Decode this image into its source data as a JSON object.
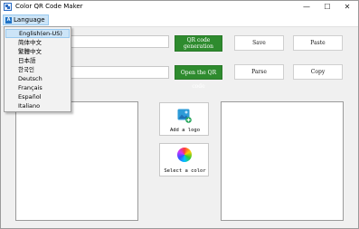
{
  "window": {
    "title": "Color QR Code Maker",
    "controls": {
      "minimize": "—",
      "maximize": "☐",
      "close": "✕"
    }
  },
  "menubar": {
    "language_label": "Language",
    "language_icon": "A"
  },
  "language_menu": {
    "items": [
      "English(en-US)",
      "简体中文",
      "繁體中文",
      "日本語",
      "한국인",
      "Deutsch",
      "Français",
      "Español",
      "Italiano"
    ],
    "selected": "English(en-US)"
  },
  "buttons": {
    "generate": "QR code\ngeneration",
    "save": "Save",
    "paste": "Paste",
    "open": "Open the QR code",
    "parse": "Parse",
    "copy": "Copy",
    "add_logo": "Add a logo",
    "select_color": "Select a color"
  },
  "colors": {
    "accent_green": "#2e8b2e",
    "menu_highlight": "#cce4f7"
  }
}
